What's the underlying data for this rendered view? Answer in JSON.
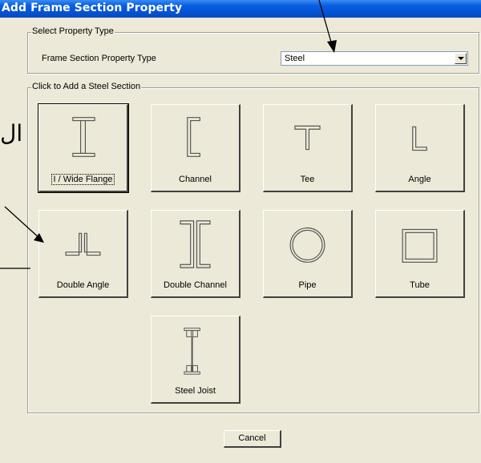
{
  "window": {
    "title": "Add Frame Section Property"
  },
  "select_group": {
    "label": "Select Property Type",
    "field_label": "Frame Section Property Type",
    "selected_value": "Steel"
  },
  "sections_group": {
    "label": "Click to Add a Steel Section",
    "buttons": [
      {
        "label": "I / Wide Flange",
        "icon": "i-beam-icon"
      },
      {
        "label": "Channel",
        "icon": "channel-icon"
      },
      {
        "label": "Tee",
        "icon": "tee-icon"
      },
      {
        "label": "Angle",
        "icon": "angle-icon"
      },
      {
        "label": "Double Angle",
        "icon": "double-angle-icon"
      },
      {
        "label": "Double Channel",
        "icon": "double-channel-icon"
      },
      {
        "label": "Pipe",
        "icon": "pipe-icon"
      },
      {
        "label": "Tube",
        "icon": "tube-icon"
      },
      {
        "label": "Steel Joist",
        "icon": "steel-joist-icon"
      }
    ]
  },
  "cancel_label": "Cancel",
  "side_annotation": "ال"
}
